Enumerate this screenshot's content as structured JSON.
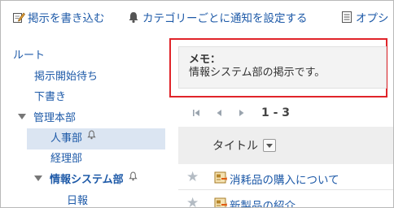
{
  "toolbar": {
    "write_label": "掲示を書き込む",
    "notify_label": "カテゴリーごとに通知を設定する",
    "option_label": "オプシ"
  },
  "sidebar": {
    "items": [
      {
        "label": "ルート"
      },
      {
        "label": "掲示開始待ち"
      },
      {
        "label": "下書き"
      },
      {
        "label": "管理本部"
      },
      {
        "label": "人事部"
      },
      {
        "label": "経理部"
      },
      {
        "label": "情報システム部"
      },
      {
        "label": "日報"
      }
    ]
  },
  "memo": {
    "title": "メモ：",
    "body": "情報システム部の掲示です。"
  },
  "pager": {
    "range": "1 - 3"
  },
  "table": {
    "column_title": "タイトル",
    "rows": [
      {
        "title": "消耗品の購入について"
      },
      {
        "title": "新製品の紹介"
      }
    ]
  },
  "colors": {
    "link": "#1e5aa8",
    "highlight": "#e0242a",
    "selected_bg": "#dbe5f2"
  }
}
